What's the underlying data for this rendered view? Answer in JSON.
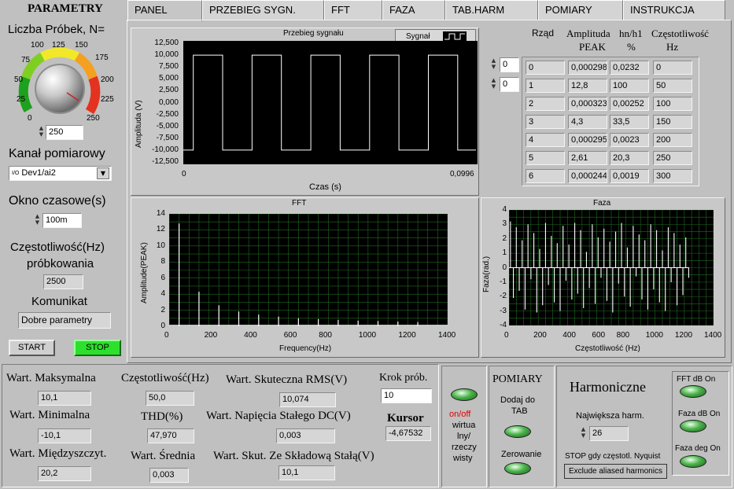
{
  "tabs": [
    "PANEL",
    "PRZEBIEG SYGN.",
    "FFT",
    "FAZA",
    "TAB.HARM",
    "POMIARY",
    "INSTRUKCJA"
  ],
  "left": {
    "title": "PARAMETRY",
    "n_label": "Liczba Próbek, N=",
    "knob_scale": [
      "0",
      "25",
      "50",
      "75",
      "100",
      "125",
      "150",
      "175",
      "200",
      "225",
      "250"
    ],
    "knob_value": "250",
    "channel_label": "Kanał pomiarowy",
    "channel_icon": "I/O",
    "channel_value": "Dev1/ai2",
    "window_label": "Okno czasowe(s)",
    "window_value": "100m",
    "freq_label1": "Częstotliwość(Hz)",
    "freq_label2": "próbkowania",
    "freq_value": "2500",
    "msg_label": "Komunikat",
    "msg_value": "Dobre parametry",
    "start": "START",
    "stop": "STOP"
  },
  "signal_plot": {
    "title": "Przebieg sygnału",
    "legend": "Sygnał",
    "ylabel": "Amplituda (V)",
    "xlabel": "Czas (s)",
    "yticks": [
      "12,500",
      "10,000",
      "7,500",
      "5,000",
      "2,500",
      "0,000",
      "-2,500",
      "-5,000",
      "-7,500",
      "-10,000",
      "-12,500"
    ],
    "xticks": [
      "0",
      "0,0996"
    ],
    "colors": {
      "bg": "#000000",
      "trace": "#ffffff"
    }
  },
  "harm_table": {
    "headers": {
      "order": "Rząd",
      "amp1": "Amplituda",
      "amp2": "PEAK",
      "hn1": "hn/h1",
      "hn2": "%",
      "freq1": "Częstotliwość",
      "freq2": "Hz"
    },
    "index1": "0",
    "index2": "0",
    "rows": [
      [
        "0",
        "0,000298",
        "0,0232",
        "0"
      ],
      [
        "1",
        "12,8",
        "100",
        "50"
      ],
      [
        "2",
        "0,000323",
        "0,00252",
        "100"
      ],
      [
        "3",
        "4,3",
        "33,5",
        "150"
      ],
      [
        "4",
        "0,000295",
        "0,0023",
        "200"
      ],
      [
        "5",
        "2,61",
        "20,3",
        "250"
      ],
      [
        "6",
        "0,000244",
        "0,0019",
        "300"
      ]
    ]
  },
  "fft_plot": {
    "title": "FFT",
    "ylabel": "Amplitude(PEAK)",
    "xlabel": "Frequency(Hz)",
    "yticks": [
      "14",
      "12",
      "10",
      "8",
      "6",
      "4",
      "2",
      "0"
    ],
    "xticks": [
      "0",
      "200",
      "400",
      "600",
      "800",
      "1000",
      "1200",
      "1400"
    ],
    "colors": {
      "bg": "#000000",
      "grid": "#1f6b1f",
      "trace": "#ffffff"
    }
  },
  "phase_plot": {
    "title": "Faza",
    "ylabel": "Faza(rad.)",
    "xlabel": "Częstotliwość (Hz)",
    "yticks": [
      "4",
      "3",
      "2",
      "1",
      "0",
      "-1",
      "-2",
      "-3",
      "-4"
    ],
    "xticks": [
      "0",
      "200",
      "400",
      "600",
      "800",
      "1000",
      "1200",
      "1400"
    ]
  },
  "chart_data": [
    {
      "type": "line",
      "title": "Przebieg sygnału",
      "xlabel": "Czas (s)",
      "ylabel": "Amplituda (V)",
      "xlim": [
        0,
        0.0996
      ],
      "ylim": [
        -12.5,
        12.5
      ],
      "series": [
        {
          "name": "Sygnał",
          "x": [
            0,
            0.0034,
            0.0034,
            0.0134,
            0.0134,
            0.0234,
            0.0234,
            0.0334,
            0.0334,
            0.0434,
            0.0434,
            0.0534,
            0.0534,
            0.0634,
            0.0634,
            0.0734,
            0.0734,
            0.0834,
            0.0834,
            0.0934,
            0.0934,
            0.0996
          ],
          "y": [
            -10,
            -10,
            10,
            10,
            -10,
            -10,
            10,
            10,
            -10,
            -10,
            10,
            10,
            -10,
            -10,
            10,
            10,
            -10,
            -10,
            10,
            10,
            -10,
            -10
          ]
        }
      ]
    },
    {
      "type": "bar",
      "title": "FFT",
      "xlabel": "Frequency(Hz)",
      "ylabel": "Amplitude(PEAK)",
      "xlim": [
        0,
        1400
      ],
      "ylim": [
        0,
        14
      ],
      "grid": true,
      "series": [
        {
          "name": "FFT",
          "x": [
            50,
            150,
            250,
            350,
            450,
            550,
            650,
            750,
            850,
            950,
            1050,
            1150,
            1250
          ],
          "y": [
            12.8,
            4.3,
            2.61,
            1.84,
            1.45,
            1.2,
            1.0,
            0.9,
            0.8,
            0.7,
            0.65,
            0.58,
            0.52
          ]
        }
      ]
    },
    {
      "type": "bar",
      "title": "Faza",
      "xlabel": "Częstotliwość (Hz)",
      "ylabel": "Faza(rad.)",
      "xlim": [
        0,
        1400
      ],
      "ylim": [
        -4,
        4
      ],
      "grid": true,
      "series": [
        {
          "name": "Faza",
          "x": [
            10,
            30,
            50,
            70,
            90,
            110,
            130,
            150,
            170,
            190,
            210,
            230,
            250,
            270,
            290,
            310,
            330,
            350,
            370,
            390,
            410,
            430,
            450,
            470,
            490,
            510,
            530,
            550,
            570,
            590,
            610,
            630,
            650,
            670,
            690,
            710,
            730,
            750,
            770,
            790,
            810,
            830,
            850,
            870,
            890,
            910,
            930,
            950,
            970,
            990,
            1010,
            1030,
            1050,
            1070,
            1090,
            1110,
            1130,
            1150,
            1170,
            1190,
            1210,
            1230
          ],
          "y": [
            3.2,
            -2.1,
            2.8,
            -1.6,
            1.9,
            -2.9,
            3.0,
            -0.8,
            2.4,
            -3.1,
            1.3,
            -2.6,
            3.1,
            -1.2,
            2.2,
            -2.4,
            1.7,
            -3.0,
            2.9,
            -0.9,
            1.6,
            -2.2,
            3.1,
            -1.8,
            2.6,
            -2.8,
            1.1,
            -1.4,
            3.0,
            -2.5,
            2.1,
            -0.7,
            2.7,
            -2.3,
            1.8,
            -3.1,
            2.5,
            -1.1,
            3.1,
            -2.0,
            1.4,
            -2.7,
            2.9,
            -0.6,
            2.3,
            -2.2,
            1.9,
            -2.9,
            3.0,
            -1.5,
            2.6,
            -2.4,
            1.2,
            -3.0,
            2.8,
            -1.0,
            2.4,
            -2.6,
            1.6,
            -1.9,
            2.1,
            -0.7
          ]
        }
      ]
    }
  ],
  "bottom": {
    "max_label": "Wart. Maksymalna",
    "max_value": "10,1",
    "min_label": "Wart. Minimalna",
    "min_value": "-10,1",
    "pp_label": "Wart. Międzyszczyt.",
    "pp_value": "20,2",
    "freq_label": "Częstotliwość(Hz)",
    "freq_value": "50,0",
    "thd_label": "THD(%)",
    "thd_value": "47,970",
    "mean_label": "Wart. Średnia",
    "mean_value": "0,003",
    "rms_label": "Wart. Skuteczna RMS(V)",
    "rms_value": "10,074",
    "dc_label": "Wart. Napięcia Stałego DC(V)",
    "dc_value": "0,003",
    "rmsdc_label": "Wart. Skut. Ze Składową Stałą(V)",
    "rmsdc_value": "10,1",
    "step_label": "Krok prób.",
    "step_value": "10",
    "cursor_label": "Kursor",
    "cursor_value": "-4,67532"
  },
  "onoff": {
    "label1": "on/off",
    "label2": "wirtua",
    "label3": "lny/",
    "label4": "rzeczy",
    "label5": "wisty"
  },
  "pomiary": {
    "title": "POMIARY",
    "add1": "Dodaj do",
    "add2": "TAB",
    "zero": "Zerowanie"
  },
  "harm": {
    "title": "Harmoniczne",
    "max_label": "Największa harm.",
    "max_value": "26",
    "stop_label": "STOP gdy częstotl. Nyquist",
    "exclude": "Exclude aliased harmonics",
    "fft_db": "FFT dB On",
    "phase_db": "Faza dB On",
    "phase_deg": "Faza deg On"
  }
}
